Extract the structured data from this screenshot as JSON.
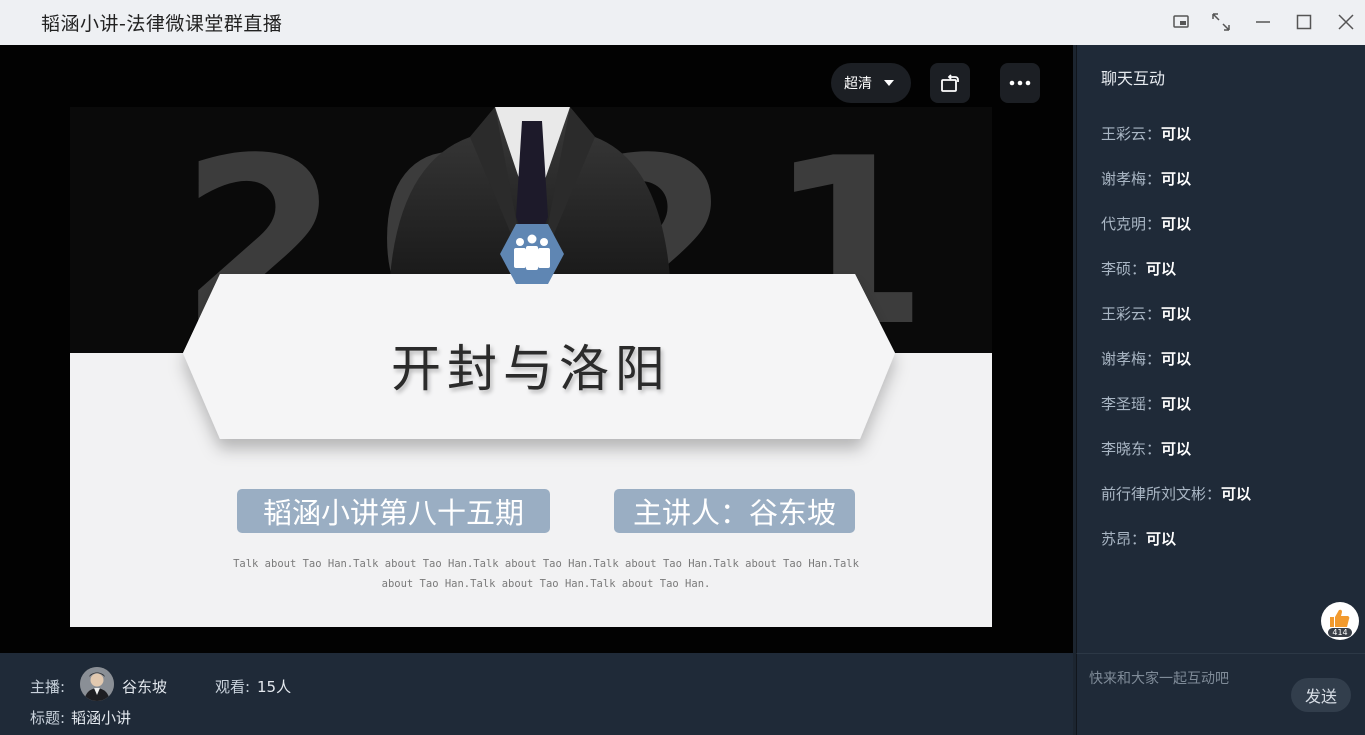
{
  "window": {
    "title": "韬涵小讲-法律微课堂群直播"
  },
  "player": {
    "quality_label": "超清"
  },
  "slide": {
    "year": "2021",
    "title": "开封与洛阳",
    "tag_episode": "韬涵小讲第八十五期",
    "tag_speaker": "主讲人：谷东坡",
    "tagline": "Talk about Tao Han.Talk about Tao Han.Talk about Tao Han.Talk about Tao Han.Talk about Tao Han.Talk about Tao Han.Talk about Tao Han.Talk about Tao Han."
  },
  "info": {
    "host_label": "主播:",
    "host_name": "谷东坡",
    "viewers_label": "观看:",
    "viewers_value": "15人",
    "topic_label": "标题:",
    "topic_value": "韬涵小讲"
  },
  "chat": {
    "title": "聊天互动",
    "messages": [
      {
        "name": "王彩云：",
        "text": "可以"
      },
      {
        "name": "谢孝梅：",
        "text": "可以"
      },
      {
        "name": "代克明：",
        "text": "可以"
      },
      {
        "name": "李硕：",
        "text": "可以"
      },
      {
        "name": "王彩云：",
        "text": "可以"
      },
      {
        "name": "谢孝梅：",
        "text": "可以"
      },
      {
        "name": "李圣瑶：",
        "text": "可以"
      },
      {
        "name": "李晓东：",
        "text": "可以"
      },
      {
        "name": "前行律所刘文彬：",
        "text": "可以"
      },
      {
        "name": "苏昂：",
        "text": "可以"
      }
    ],
    "like_count": "414",
    "input_placeholder": "快来和大家一起互动吧",
    "send_label": "发送"
  },
  "icons": {
    "titlebar": [
      "pip-icon",
      "fullscreen-icon",
      "minimize-icon",
      "maximize-icon",
      "close-icon"
    ],
    "player": [
      "rotate-screen-icon",
      "more-icon"
    ],
    "slide": [
      "team-hexagon-icon"
    ],
    "chat": [
      "thumbs-up-icon"
    ]
  },
  "colors": {
    "titlebar_bg": "#eef0f3",
    "panel_bg": "#1f2a38",
    "slide_tag": "#9aaec3",
    "hexagon": "#5f86b3"
  }
}
